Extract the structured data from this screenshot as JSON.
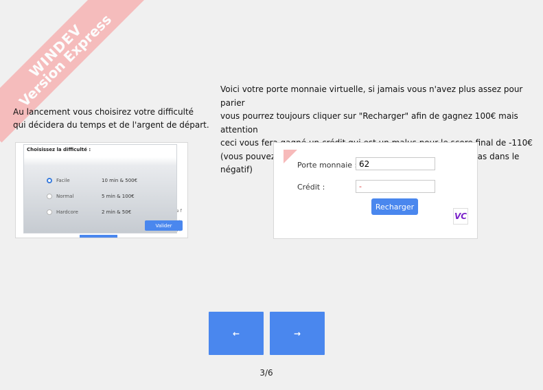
{
  "watermark": {
    "line1": "WINDEV",
    "line2": "Version Express"
  },
  "intro_left": {
    "line1": "Au lancement vous choisirez votre difficulté",
    "line2": "qui décidera du temps et de l'argent de départ."
  },
  "intro_right": {
    "line1": "Voici votre porte monnaie virtuelle, si jamais vous n'avez plus assez pour parier",
    "line2": "vous pourrez toujours cliquer sur \"Recharger\" afin de gagnez 100€ mais attention",
    "line3": "ceci vous fera gagné un crédit qui est un malus pour le score final de -110€",
    "line4": "(vous pouvez utiliser l'option recharger même si vous n'êtes pas dans le négatif)"
  },
  "difficulty_preview": {
    "title": "Choisissez la difficulté :",
    "options": [
      {
        "label": "Facile",
        "value": "10 min & 500€",
        "selected": true
      },
      {
        "label": "Normal",
        "value": "5 min & 100€",
        "selected": false
      },
      {
        "label": "Hardcore",
        "value": "2 min & 50€",
        "selected": false
      }
    ],
    "validate_label": "Valider"
  },
  "wallet_preview": {
    "wallet_label": "Porte monnaie :",
    "wallet_value": "62",
    "credit_label": "Crédit :",
    "credit_value": "-",
    "recharge_label": "Recharger",
    "badge_text": "VC"
  },
  "navigation": {
    "prev_label": "←",
    "next_label": "→",
    "page_indicator": "3/6"
  },
  "colors": {
    "accent": "#4a87ee",
    "watermark": "#f6b3b3",
    "background": "#f0f0f0"
  }
}
